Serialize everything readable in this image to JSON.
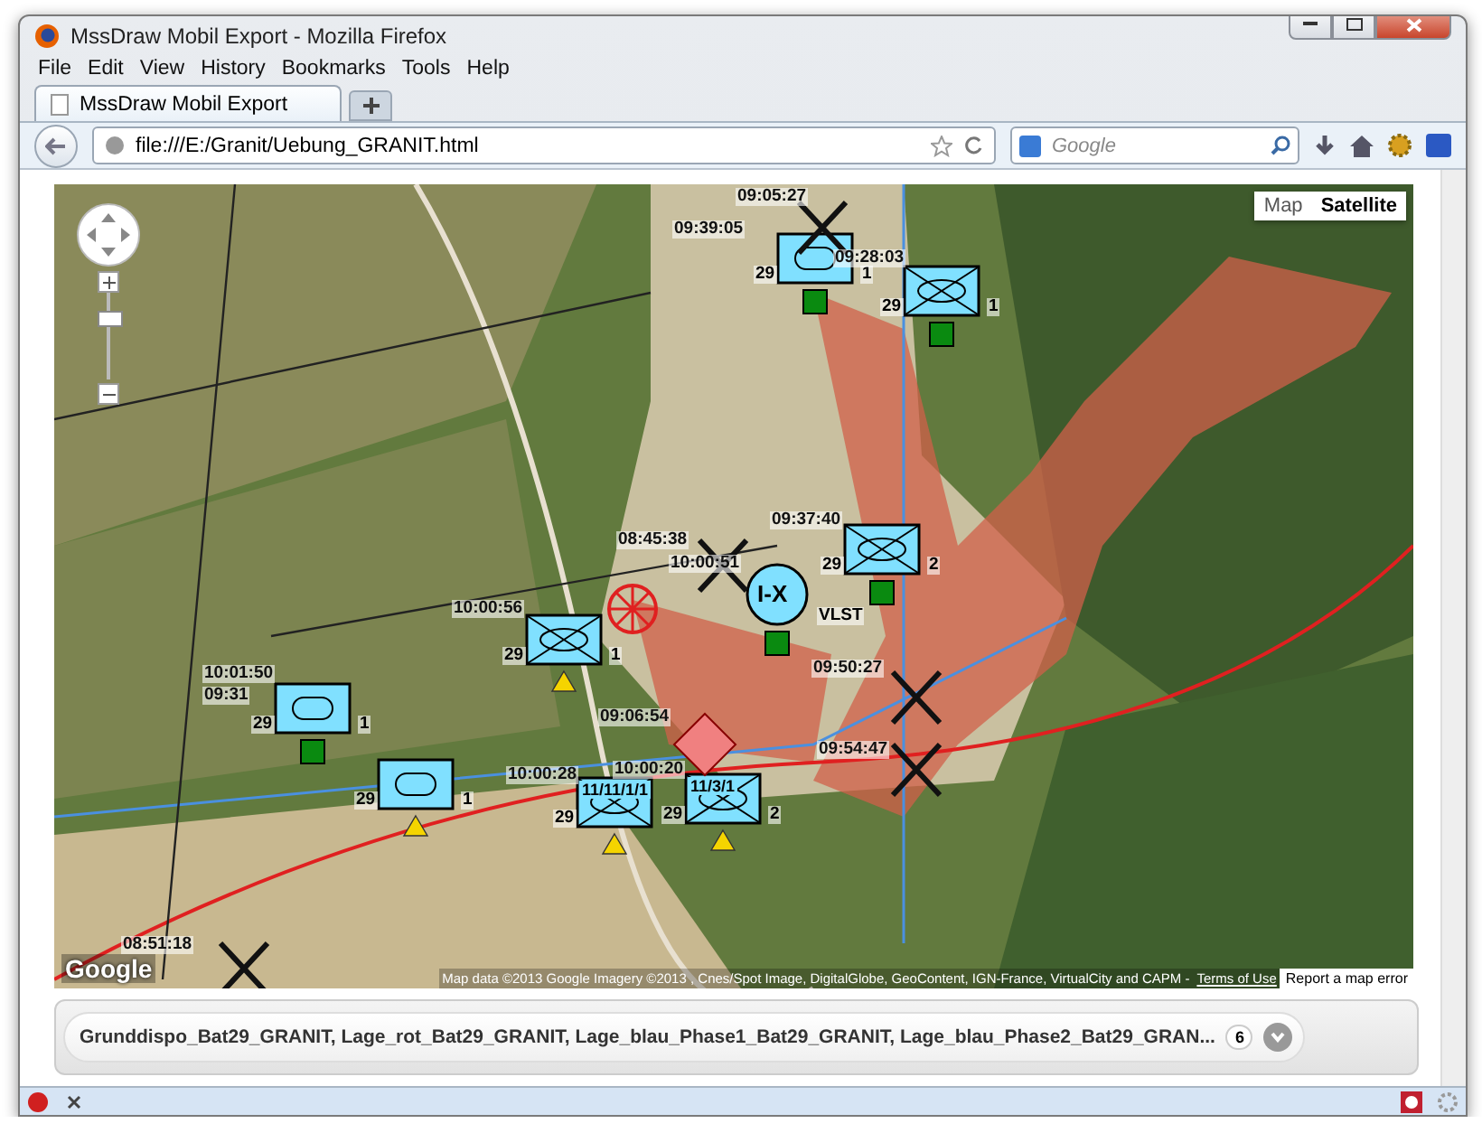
{
  "window": {
    "title": "MssDraw Mobil Export - Mozilla Firefox"
  },
  "menu": [
    "File",
    "Edit",
    "View",
    "History",
    "Bookmarks",
    "Tools",
    "Help"
  ],
  "tabs": [
    {
      "label": "MssDraw Mobil Export",
      "selected": true
    }
  ],
  "address": {
    "value": "file:///E:/Granit/Uebung_GRANIT.html"
  },
  "search": {
    "placeholder": "Google"
  },
  "map": {
    "type_buttons": [
      {
        "label": "Map",
        "selected": false
      },
      {
        "label": "Satellite",
        "selected": true
      }
    ],
    "units": [
      {
        "kind": "armor",
        "left_label": "29",
        "right_label": "1",
        "marker": {
          "kind": "square",
          "color": "#0a8a10"
        }
      },
      {
        "kind": "infantry",
        "left_label": "29",
        "right_label": "1",
        "marker": {
          "kind": "square",
          "color": "#0a8a10"
        }
      },
      {
        "kind": "infantry",
        "left_label": "29",
        "right_label": "2",
        "marker": {
          "kind": "square",
          "color": "#0a8a10"
        }
      },
      {
        "kind": "hq",
        "designation": "I-X",
        "right_label": "VLST",
        "marker": {
          "kind": "square",
          "color": "#0a8a10"
        }
      },
      {
        "kind": "infantry",
        "left_label": "29",
        "right_label": "1",
        "marker": {
          "kind": "triangle",
          "color": "#f5d400"
        }
      },
      {
        "kind": "armor",
        "left_label": "29",
        "right_label": "1",
        "marker": {
          "kind": "square",
          "color": "#0a8a10"
        }
      },
      {
        "kind": "armor",
        "left_label": "29",
        "right_label": "1",
        "marker": {
          "kind": "triangle",
          "color": "#f5d400"
        }
      },
      {
        "kind": "infantry",
        "left_label": "29",
        "designation": "11/11/1/1",
        "marker": {
          "kind": "triangle",
          "color": "#f5d400"
        }
      },
      {
        "kind": "infantry",
        "left_label": "29",
        "designation": "11/3/1",
        "right_label": "2",
        "marker": {
          "kind": "triangle",
          "color": "#f5d400"
        }
      }
    ],
    "times": [
      "09:05:27",
      "09:39:05",
      "09:28:03",
      "09:37:40",
      "08:45:38",
      "10:00:51",
      "10:00:56",
      "10:01:50",
      "09:31",
      "09:50:27",
      "09:06:54",
      "09:54:47",
      "10:00:20",
      "10:00:28",
      "08:51:18"
    ],
    "logo": "Google",
    "attribution": "Map data ©2013 Google Imagery ©2013 , Cnes/Spot Image, DigitalGlobe, GeoContent, IGN-France, VirtualCity and CAPM - ",
    "terms": "Terms of Use",
    "report": "Report a map error"
  },
  "layers": {
    "text": "Grunddispo_Bat29_GRANIT, Lage_rot_Bat29_GRANIT, Lage_blau_Phase1_Bat29_GRANIT, Lage_blau_Phase2_Bat29_GRAN...",
    "count": "6"
  }
}
